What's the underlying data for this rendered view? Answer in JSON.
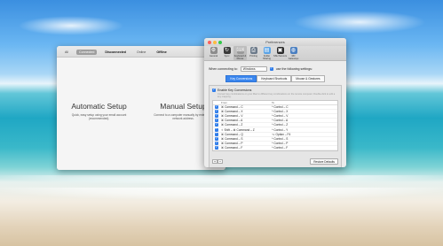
{
  "manager": {
    "tabs": [
      "All",
      "Connected",
      "Disconnected",
      "Online",
      "Offline"
    ],
    "active_tab": "Connected",
    "automatic": {
      "title": "Automatic Setup",
      "description": "Quick, easy setup using your email account (recommended)."
    },
    "manual": {
      "title": "Manual Setup",
      "description": "Connect to a computer manually by entering its network address."
    }
  },
  "prefs": {
    "window_title": "Preferences",
    "toolbar": [
      {
        "label": "General",
        "icon": "gear-icon",
        "color": "#8c8c8c",
        "glyph": "⚙"
      },
      {
        "label": "Sync",
        "icon": "sync-icon",
        "color": "#3a3a3a",
        "glyph": "↻"
      },
      {
        "label": "Keyboard & Mouse",
        "icon": "keyboard-icon",
        "color": "#9a9a9a",
        "glyph": "⌨"
      },
      {
        "label": "Printing",
        "icon": "printer-icon",
        "color": "#6c7a8a",
        "glyph": "⎙"
      },
      {
        "label": "Folder Sharing",
        "icon": "folder-icon",
        "color": "#5aa3e6",
        "glyph": "▤"
      },
      {
        "label": "SSH Servers",
        "icon": "terminal-icon",
        "color": "#2b2b2b",
        "glyph": "▣"
      },
      {
        "label": "RD Gateways",
        "icon": "globe-icon",
        "color": "#4a7fc1",
        "glyph": "◍"
      }
    ],
    "when_connecting_label": "When connecting to:",
    "os_value": "Windows",
    "use_following_label": "use the following settings:",
    "segments": [
      "Key Conversions",
      "Keyboard Shortcuts",
      "Mouse & Gestures"
    ],
    "active_segment": "Key Conversions",
    "enable_label": "Enable Key Conversions",
    "enable_desc": "Convert key combinations on your Mac to different key combinations on the remote computer. Double-click to edit a key mapping.",
    "col_from": "From",
    "col_to": "To",
    "mappings": [
      {
        "from": "⌘ Command – C",
        "to": "^ Control – C"
      },
      {
        "from": "⌘ Command – X",
        "to": "^ Control – X"
      },
      {
        "from": "⌘ Command – V",
        "to": "^ Control – V"
      },
      {
        "from": "⌘ Command – A",
        "to": "^ Control – A"
      },
      {
        "from": "⌘ Command – Z",
        "to": "^ Control – Z"
      },
      {
        "from": "⇧ Shift – ⌘ Command – Z",
        "to": "^ Control – Y"
      },
      {
        "from": "⌘ Command – Q",
        "to": "⌥ Option – F4"
      },
      {
        "from": "⌘ Command – S",
        "to": "^ Control – S"
      },
      {
        "from": "⌘ Command – P",
        "to": "^ Control – P"
      },
      {
        "from": "⌘ Command – F",
        "to": "^ Control – F"
      }
    ],
    "restore_label": "Restore Defaults"
  }
}
